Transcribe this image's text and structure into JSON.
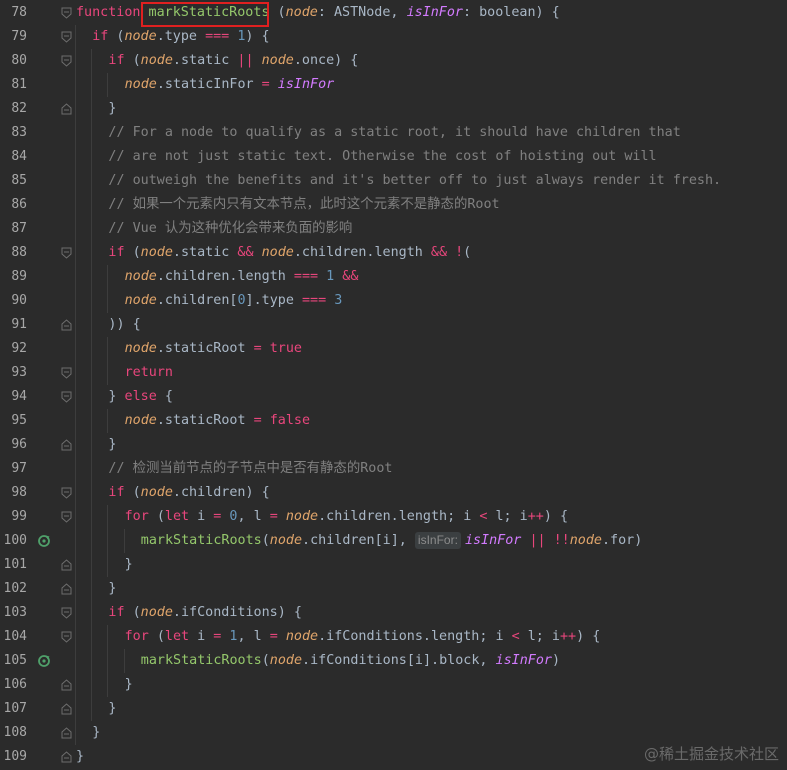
{
  "editor": {
    "watermark": "@稀土掘金技术社区",
    "lines": [
      {
        "n": "78"
      },
      {
        "n": "79"
      },
      {
        "n": "80"
      },
      {
        "n": "81"
      },
      {
        "n": "82"
      },
      {
        "n": "83"
      },
      {
        "n": "84"
      },
      {
        "n": "85"
      },
      {
        "n": "86"
      },
      {
        "n": "87"
      },
      {
        "n": "88"
      },
      {
        "n": "89"
      },
      {
        "n": "90"
      },
      {
        "n": "91"
      },
      {
        "n": "92"
      },
      {
        "n": "93"
      },
      {
        "n": "94"
      },
      {
        "n": "95"
      },
      {
        "n": "96"
      },
      {
        "n": "97"
      },
      {
        "n": "98"
      },
      {
        "n": "99"
      },
      {
        "n": "100"
      },
      {
        "n": "101"
      },
      {
        "n": "102"
      },
      {
        "n": "103"
      },
      {
        "n": "104"
      },
      {
        "n": "105"
      },
      {
        "n": "106"
      },
      {
        "n": "107"
      },
      {
        "n": "108"
      },
      {
        "n": "109"
      }
    ],
    "tokens": {
      "function": "function",
      "fn_name": "markStaticRoots",
      "param_node": "node",
      "ast_type": ": ASTNode, ",
      "param_isInFor": "isInFor",
      "bool_type": ": boolean) {",
      "open_paren": " (",
      "l79": [
        "if",
        " (",
        "node",
        ".type ",
        "===",
        " ",
        "1",
        ") {"
      ],
      "l80": [
        "if",
        " (",
        "node",
        ".static ",
        "||",
        " ",
        "node",
        ".once) {"
      ],
      "l81": [
        "node",
        ".staticInFor ",
        "=",
        " ",
        "isInFor"
      ],
      "l82": "}",
      "l83": "// For a node to qualify as a static root, it should have children that",
      "l84": "// are not just static text. Otherwise the cost of hoisting out will",
      "l85": "// outweigh the benefits and it's better off to just always render it fresh.",
      "l86": "// 如果一个元素内只有文本节点，此时这个元素不是静态的Root",
      "l87": "// Vue 认为这种优化会带来负面的影响",
      "l88": [
        "if",
        " (",
        "node",
        ".static ",
        "&&",
        " ",
        "node",
        ".children.length ",
        "&&",
        " ",
        "!",
        "("
      ],
      "l89": [
        "node",
        ".children.length ",
        "===",
        " ",
        "1",
        " ",
        "&&"
      ],
      "l90": [
        "node",
        ".children[",
        "0",
        "].type ",
        "===",
        " ",
        "3"
      ],
      "l91": ")) {",
      "l92": [
        "node",
        ".staticRoot ",
        "=",
        " ",
        "true"
      ],
      "l93": "return",
      "l94": [
        "} ",
        "else",
        " {"
      ],
      "l95": [
        "node",
        ".staticRoot ",
        "=",
        " ",
        "false"
      ],
      "l96": "}",
      "l97": "// 检测当前节点的子节点中是否有静态的Root",
      "l98": [
        "if",
        " (",
        "node",
        ".children) {"
      ],
      "l99": [
        "for",
        " (",
        "let",
        " i ",
        "=",
        " ",
        "0",
        ", l ",
        "=",
        " ",
        "node",
        ".children.length; i ",
        "<",
        " l; i",
        "++",
        ") {"
      ],
      "l100": [
        "markStaticRoots",
        "(",
        "node",
        ".children[i], ",
        "isInFor:",
        "isInFor",
        " ",
        "||",
        " ",
        "!!",
        "node",
        ".for)"
      ],
      "l101": "}",
      "l102": "}",
      "l103": [
        "if",
        " (",
        "node",
        ".ifConditions) {"
      ],
      "l104": [
        "for",
        " (",
        "let",
        " i ",
        "=",
        " ",
        "1",
        ", l ",
        "=",
        " ",
        "node",
        ".ifConditions.length; i ",
        "<",
        " l; i",
        "++",
        ") {"
      ],
      "l105": [
        "markStaticRoots",
        "(",
        "node",
        ".ifConditions[i].block, ",
        "isInFor",
        ")"
      ],
      "l106": "}",
      "l107": "}",
      "l108": "}",
      "l109": "}"
    }
  },
  "colors": {
    "background": "#2b2b2b",
    "highlight_box": "#e02020",
    "function_name": "#94c76b",
    "keyword": "#e8467c",
    "parameter": "#e0a56b",
    "number": "#6897bb",
    "comment": "#808080"
  }
}
